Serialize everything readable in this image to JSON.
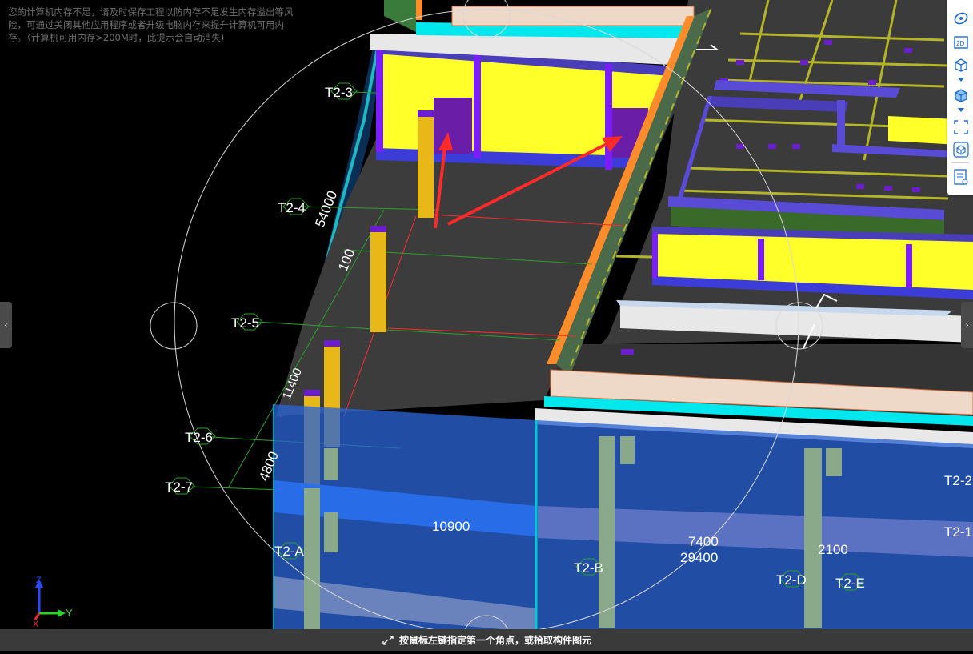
{
  "warning": {
    "line1": "您的计算机内存不足，请及时保存工程以防内存不足发生内存溢出等风",
    "line2": "险，可通过关闭其他应用程序或者升级电脑内存来提升计算机可用内",
    "line3": "存。（计算机可用内存>200M时，此提示会自动消失)"
  },
  "grid_labels": {
    "t2_3": "T2-3",
    "t2_4": "T2-4",
    "t2_5": "T2-5",
    "t2_6": "T2-6",
    "t2_7": "T2-7",
    "t2_a": "T2-A",
    "t2_b": "T2-B",
    "t2_d": "T2-D",
    "t2_e": "T2-E",
    "t2_2_partial": "T2-2",
    "t2_1_partial": "T2-1"
  },
  "dimensions": {
    "d54000": "54000",
    "d4800": "4800",
    "d10900": "10900",
    "d29400": "29400",
    "d7400": "7400",
    "d2100": "2100",
    "d100": "100",
    "d11400": "11400"
  },
  "toolbar": {
    "label_2d": "2D",
    "icons": [
      "orbit-icon",
      "2d-view-icon",
      "3d-cube-icon",
      "solid-cube-icon",
      "fit-view-icon",
      "view-cube-icon",
      "properties-icon"
    ]
  },
  "axis": {
    "z": "Z",
    "y": "Y",
    "x": "X"
  },
  "status": {
    "text": "按鼠标左键指定第一个角点，或拾取构件图元"
  },
  "colors": {
    "background": "#000000",
    "slab": "#3c3c3c",
    "wall_yellow": "#ffff2a",
    "column": "#e8b818",
    "beam_blue": "#3c3cd8",
    "edge_orange": "#ff8c2a",
    "glass_blue": "#2a64d2",
    "grid_green": "#2aa02a",
    "annotation_red": "#ff2a2a"
  }
}
